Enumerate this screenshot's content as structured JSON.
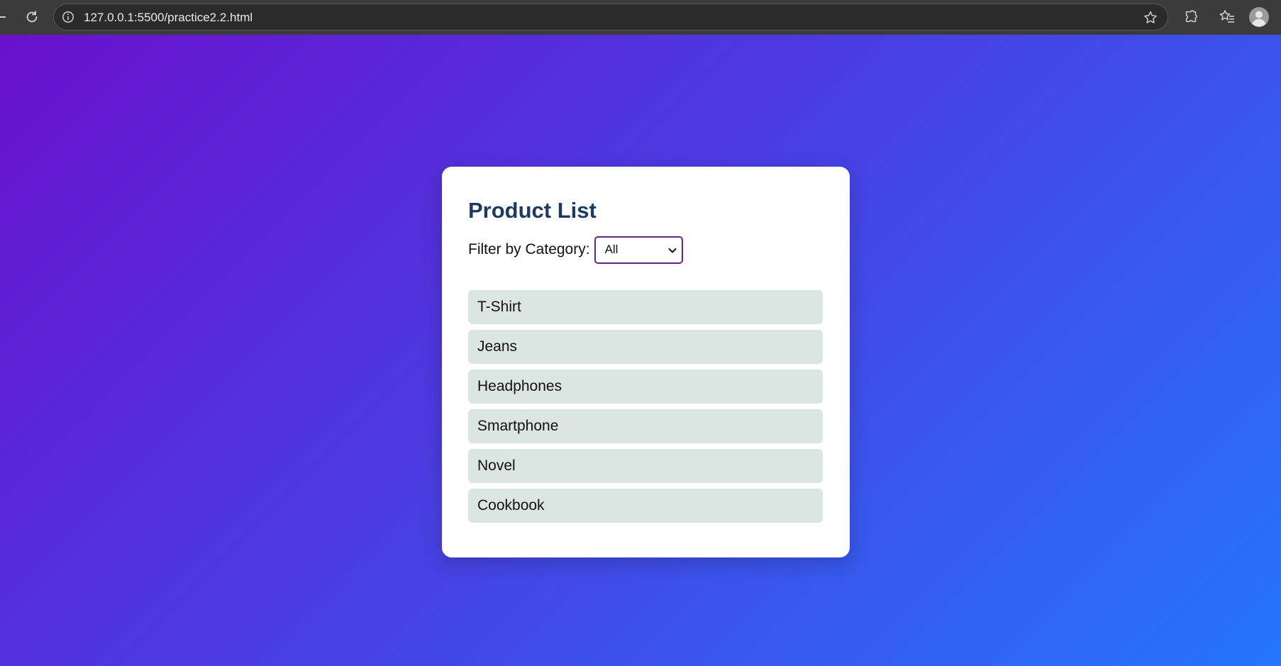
{
  "browser": {
    "url": "127.0.0.1:5500/practice2.2.html",
    "icons": [
      "reload-icon",
      "info-icon",
      "star-icon",
      "extensions-icon",
      "favorites-icon",
      "profile-icon"
    ]
  },
  "theme": {
    "gradient_start": "#6a11cb",
    "gradient_end": "#2575fc",
    "title_color": "#1f3a5f",
    "item_background": "#dbe6e3",
    "select_border": "#5b2a86"
  },
  "card": {
    "title": "Product List",
    "filter_label": "Filter by Category:",
    "filter_selected": "All",
    "products": [
      {
        "name": "T-Shirt"
      },
      {
        "name": "Jeans"
      },
      {
        "name": "Headphones"
      },
      {
        "name": "Smartphone"
      },
      {
        "name": "Novel"
      },
      {
        "name": "Cookbook"
      }
    ]
  }
}
